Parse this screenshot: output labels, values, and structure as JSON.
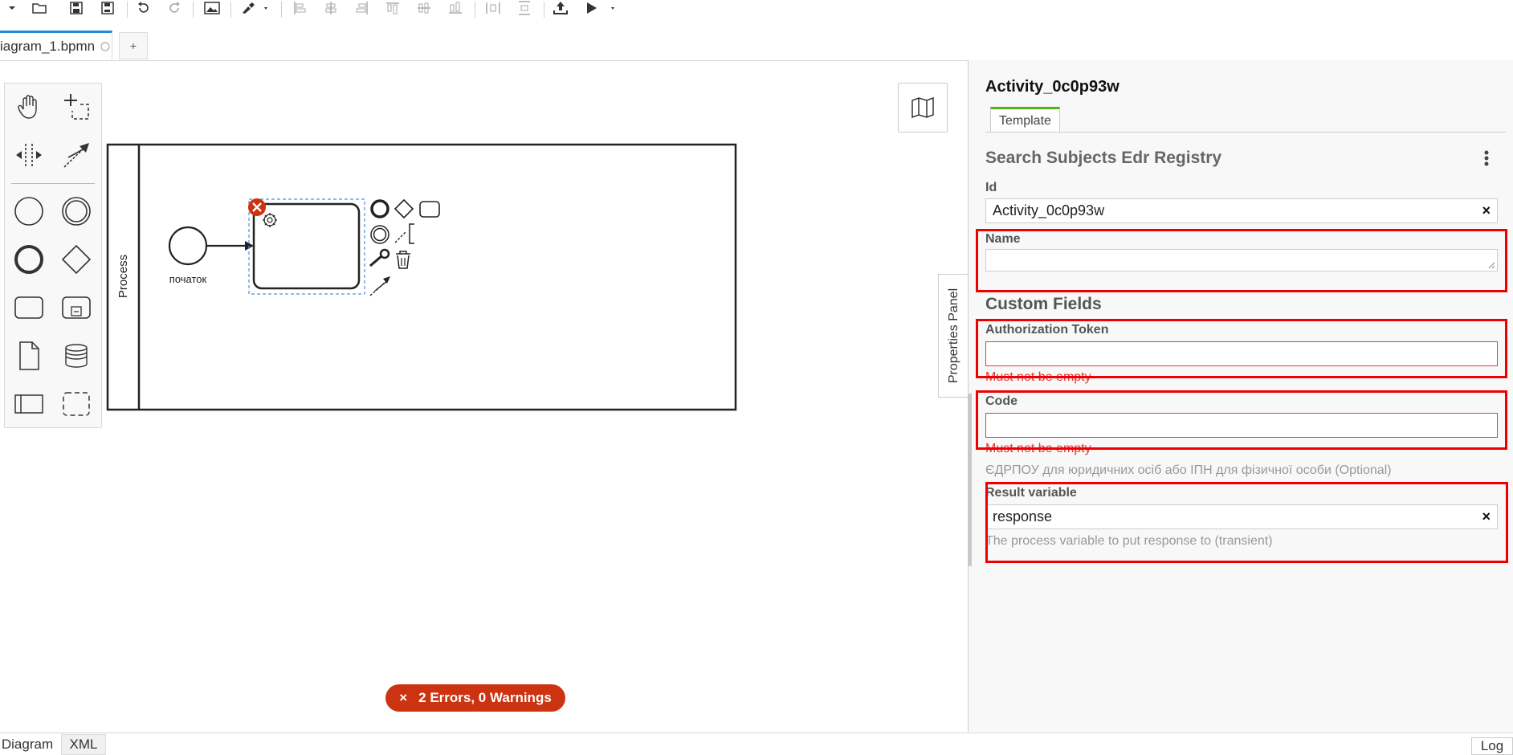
{
  "toolbar": {
    "icons": [
      "dropdown-arrow-icon",
      "open-file-icon",
      "save-icon",
      "save-as-icon",
      "undo-icon",
      "redo-icon",
      "export-image-icon",
      "color-brush-icon",
      "align-left-icon",
      "align-center-icon",
      "align-right-icon",
      "align-top-icon",
      "align-middle-icon",
      "align-bottom-icon",
      "distribute-horizontal-icon",
      "distribute-vertical-icon",
      "deploy-icon",
      "run-icon"
    ]
  },
  "tabs": {
    "file_name": "iagram_1.bpmn",
    "add_label": "+"
  },
  "canvas": {
    "pool_label": "Process",
    "start_event_label": "початок"
  },
  "properties_panel": {
    "toggle_label": "Properties Panel",
    "element_title": "Activity_0c0p93w",
    "tab_label": "Template",
    "group_title": "Search Subjects Edr Registry",
    "id_label": "Id",
    "id_value": "Activity_0c0p93w",
    "name_label": "Name",
    "name_value": "",
    "custom_fields_title": "Custom Fields",
    "auth_token_label": "Authorization Token",
    "auth_token_value": "",
    "auth_token_error": "Must not be empty",
    "code_label": "Code",
    "code_value": "",
    "code_error": "Must not be empty",
    "code_description": "ЄДРПОУ для юридичних осіб або ІПН для фізичної особи (Optional)",
    "result_var_label": "Result variable",
    "result_var_value": "response",
    "result_var_description": "The process variable to put response to (transient)",
    "clear_symbol": "×"
  },
  "status": {
    "errors_icon": "×",
    "errors_text": "2 Errors, 0 Warnings"
  },
  "bottom_tabs": {
    "diagram": "Diagram",
    "xml": "XML",
    "log": "Log"
  },
  "colors": {
    "error_red": "#cc3311",
    "highlight_red": "#ee0000",
    "tab_accent_blue": "#2b86d6",
    "tab_accent_green": "#52b415"
  }
}
